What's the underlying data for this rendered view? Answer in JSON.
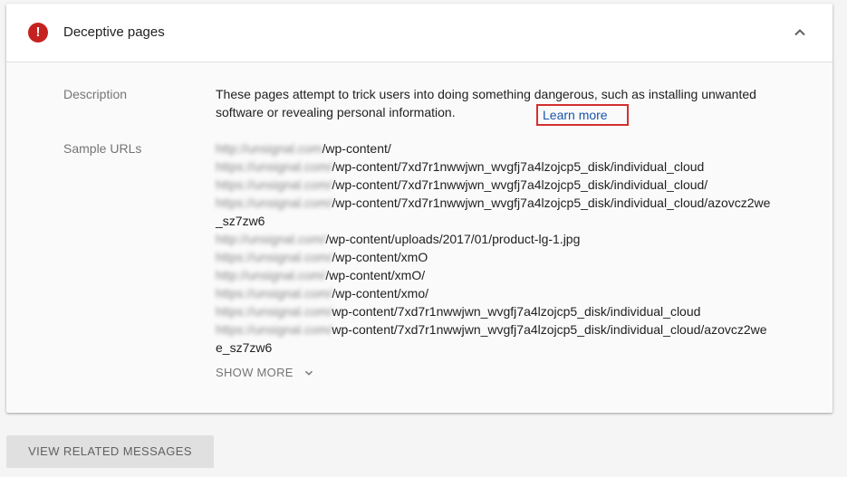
{
  "issue": {
    "title": "Deceptive pages",
    "severity_color": "#c5221f"
  },
  "description": {
    "label": "Description",
    "text": "These pages attempt to trick users into doing something dangerous, such as installing unwanted software or revealing personal information.",
    "learn_more": "Learn more"
  },
  "sample_urls": {
    "label": "Sample URLs",
    "items": [
      {
        "host": "http://unsignal.com",
        "path": "/wp-content/"
      },
      {
        "host": "https://unsignal.com/",
        "path": "/wp-content/7xd7r1nwwjwn_wvgfj7a4lzojcp5_disk/individual_cloud"
      },
      {
        "host": "https://unsignal.com/",
        "path": "/wp-content/7xd7r1nwwjwn_wvgfj7a4lzojcp5_disk/individual_cloud/"
      },
      {
        "host": "https://unsignal.com/",
        "path": "/wp-content/7xd7r1nwwjwn_wvgfj7a4lzojcp5_disk/individual_cloud/azovcz2we"
      },
      {
        "host": "",
        "path": "_sz7zw6"
      },
      {
        "host": "http://unsignal.com/",
        "path": "/wp-content/uploads/2017/01/product-lg-1.jpg"
      },
      {
        "host": "https://unsignal.com/",
        "path": "/wp-content/xmO"
      },
      {
        "host": "http://unsignal.com/",
        "path": "/wp-content/xmO/"
      },
      {
        "host": "https://unsignal.com/",
        "path": "/wp-content/xmo/"
      },
      {
        "host": "https://unsignal.com/",
        "path": "wp-content/7xd7r1nwwjwn_wvgfj7a4lzojcp5_disk/individual_cloud"
      },
      {
        "host": "https://unsignal.com/",
        "path": "wp-content/7xd7r1nwwjwn_wvgfj7a4lzojcp5_disk/individual_cloud/azovcz2we"
      },
      {
        "host": "",
        "path": "e_sz7zw6"
      }
    ],
    "show_more": "SHOW MORE"
  },
  "footer": {
    "related_button": "VIEW RELATED MESSAGES"
  },
  "icons": {
    "severity": "error-icon",
    "collapse": "chevron-up-icon",
    "expand": "chevron-down-icon"
  }
}
